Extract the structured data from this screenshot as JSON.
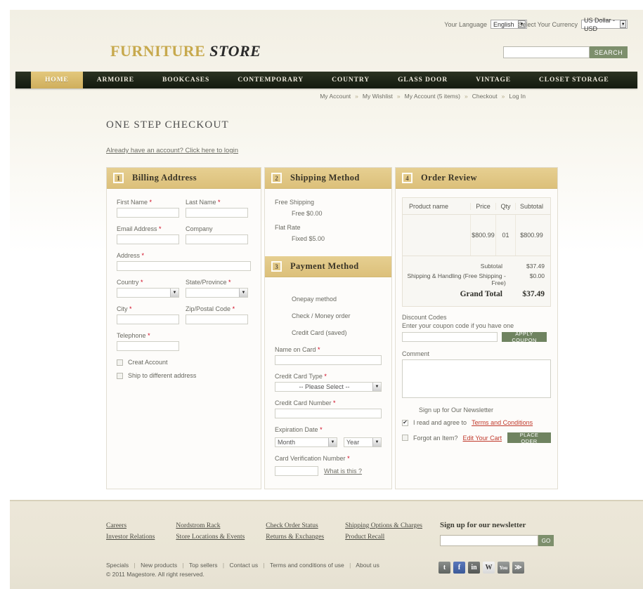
{
  "topbar": {
    "language_label": "Your Language",
    "language_value": "English",
    "currency_label": "Select Your Currency",
    "currency_value": "US Dollar - USD"
  },
  "brand": {
    "name_first": "FURNITURE",
    "name_second": "STORE",
    "search_placeholder": "",
    "search_value": "",
    "search_button": "SEARCH"
  },
  "nav": {
    "items": [
      {
        "label": "HOME",
        "active": true
      },
      {
        "label": "ARMOIRE",
        "active": false
      },
      {
        "label": "BOOKCASES",
        "active": false
      },
      {
        "label": "CONTEMPORARY",
        "active": false
      },
      {
        "label": "COUNTRY",
        "active": false
      },
      {
        "label": "GLASS DOOR",
        "active": false
      },
      {
        "label": "VINTAGE",
        "active": false
      },
      {
        "label": "CLOSET STORAGE",
        "active": false
      }
    ]
  },
  "breadcrumb": {
    "items": [
      "My Account",
      "My Wishlist",
      "My Account (5 items)",
      "Checkout",
      "Log In"
    ],
    "separator": "»"
  },
  "main": {
    "page_title": "ONE STEP CHECKOUT",
    "login_link": "Already have an account? Click here to login"
  },
  "billing": {
    "step": "1",
    "title": "Billing Addtress",
    "first_name_label": "First Name",
    "first_name_value": "",
    "last_name_label": "Last Name",
    "last_name_value": "",
    "email_label": "Email Address",
    "email_value": "",
    "company_label": "Company",
    "company_value": "",
    "address_label": "Address",
    "address_value": "",
    "country_label": "Country",
    "country_value": "",
    "state_label": "State/Province",
    "state_value": "",
    "city_label": "City",
    "city_value": "",
    "zip_label": "Zip/Postal Code",
    "zip_value": "",
    "telephone_label": "Telephone",
    "telephone_value": "",
    "create_account_label": "Creat Account",
    "ship_different_label": "Ship to different address",
    "required_mark": "*"
  },
  "shipping": {
    "step": "2",
    "title": "Shipping Method",
    "groups": [
      {
        "name": "Free Shipping",
        "option": "Free $0.00"
      },
      {
        "name": "Flat Rate",
        "option": "Fixed $5.00"
      }
    ]
  },
  "payment": {
    "step": "3",
    "title": "Payment Method",
    "methods": [
      "Onepay method",
      "Check / Money order",
      "Credit Card (saved)"
    ],
    "name_on_card_label": "Name on Card",
    "name_on_card_value": "",
    "card_type_label": "Credit Card Type",
    "card_type_value": "-- Please Select --",
    "card_number_label": "Credit Card Number",
    "card_number_value": "",
    "expiration_label": "Expiration Date",
    "expiration_month": "Month",
    "expiration_year": "Year",
    "cvn_label": "Card Verification Number",
    "cvn_value": "",
    "cvn_help": "What is this ?",
    "required_mark": "*"
  },
  "review": {
    "step": "4",
    "title": "Order Review",
    "columns": [
      "Product name",
      "Price",
      "Qty",
      "Subtotal"
    ],
    "rows": [
      {
        "product": "",
        "price": "$800.99",
        "qty": "01",
        "subtotal": "$800.99"
      }
    ],
    "totals": [
      {
        "label": "Subtotal",
        "value": "$37.49"
      },
      {
        "label": "Shipping & Handling (Free Shipping - Free)",
        "value": "$0.00"
      }
    ],
    "grand_total_label": "Grand Total",
    "grand_total_value": "$37.49",
    "discount_title": "Discount Codes",
    "discount_sub": "Enter your coupon code if you have one",
    "coupon_value": "",
    "apply_coupon_button": "APPLY COUPON",
    "comment_title": "Comment",
    "comment_value": "",
    "newsletter_label": "Sign up for Our Newsletter",
    "terms_prefix": "I read and agree to",
    "terms_link": "Terms and Conditions",
    "forgot_prefix": "Forgot an Item?",
    "forgot_link": "Edit Your Cart",
    "place_order_button": "PLACE ODER"
  },
  "footer": {
    "columns": [
      [
        "Careers",
        "Investor Relations"
      ],
      [
        "Nordstrom Rack",
        "Store Locations & Events"
      ],
      [
        "Check Order Status",
        "Returns & Exchanges"
      ],
      [
        "Shipping Options & Charges",
        "Product Recall"
      ]
    ],
    "newsletter_head": "Sign up for our newsletter",
    "newsletter_value": "",
    "newsletter_button": "GO",
    "bottom_links": [
      "Specials",
      "New products",
      "Top sellers",
      "Contact us",
      "Terms and conditions of use",
      "About us"
    ],
    "copyright": "© 2011 Magestore. All right reserved.",
    "social": [
      {
        "name": "twitter-icon",
        "glyph": "t",
        "cls": "s-tw"
      },
      {
        "name": "facebook-icon",
        "glyph": "f",
        "cls": "s-fb"
      },
      {
        "name": "linkedin-icon",
        "glyph": "in",
        "cls": "s-in"
      },
      {
        "name": "wordpress-icon",
        "glyph": "W",
        "cls": "s-wp"
      },
      {
        "name": "youtube-icon",
        "glyph": "You",
        "cls": "s-yt"
      },
      {
        "name": "rss-icon",
        "glyph": "≫",
        "cls": "s-rs"
      }
    ]
  }
}
